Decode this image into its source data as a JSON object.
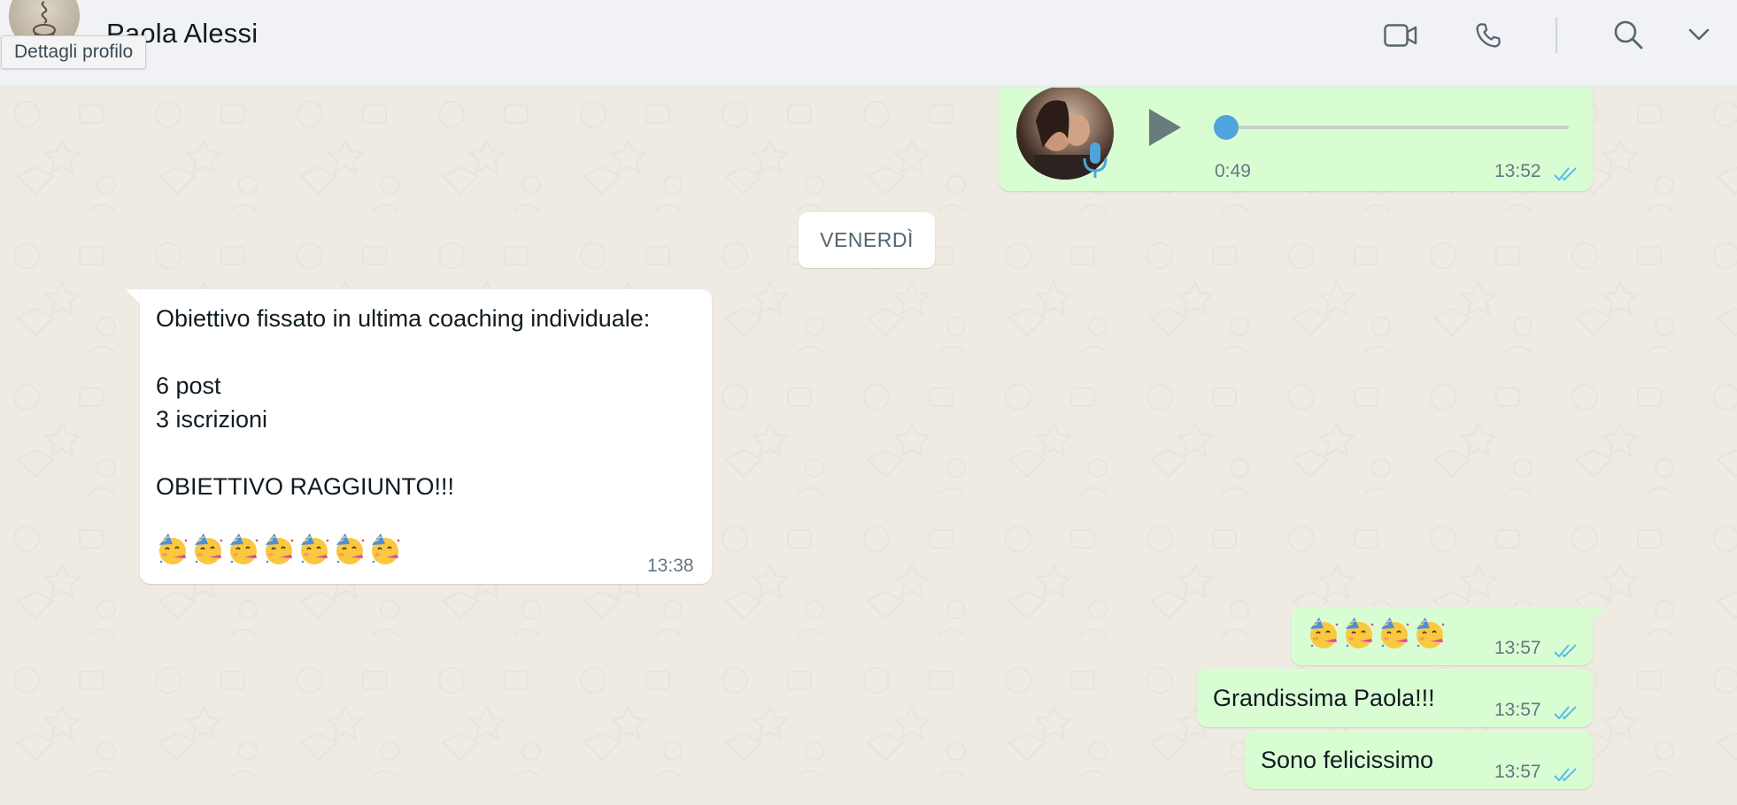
{
  "header": {
    "contact_name": "Paola Alessi",
    "tooltip": "Dettagli profilo",
    "icons": [
      "video-call-icon",
      "voice-call-icon",
      "search-icon",
      "chevron-down-icon"
    ]
  },
  "colors": {
    "outgoing_bubble": "#d9fdd3",
    "incoming_bubble": "#ffffff",
    "chat_background": "#efeae2",
    "read_ticks": "#53bdeb",
    "audio_progress": "#4fa4dc"
  },
  "voice_message": {
    "duration": "0:49",
    "time": "13:52",
    "progress": 0
  },
  "date_separator": "VENERDÌ",
  "incoming_message": {
    "lines": [
      "Obiettivo fissato in ultima coaching individuale:",
      "",
      "6 post",
      "3 iscrizioni",
      "",
      "OBIETTIVO RAGGIUNTO!!!"
    ],
    "emoji": "🥳🥳🥳🥳🥳🥳🥳",
    "emoji_count": 7,
    "time": "13:38"
  },
  "outgoing_messages": [
    {
      "text": "🥳🥳🥳🥳",
      "emoji_count": 4,
      "time": "13:57"
    },
    {
      "text": "Grandissima Paola!!!",
      "time": "13:57"
    },
    {
      "text": "Sono felicissimo",
      "time": "13:57"
    }
  ]
}
